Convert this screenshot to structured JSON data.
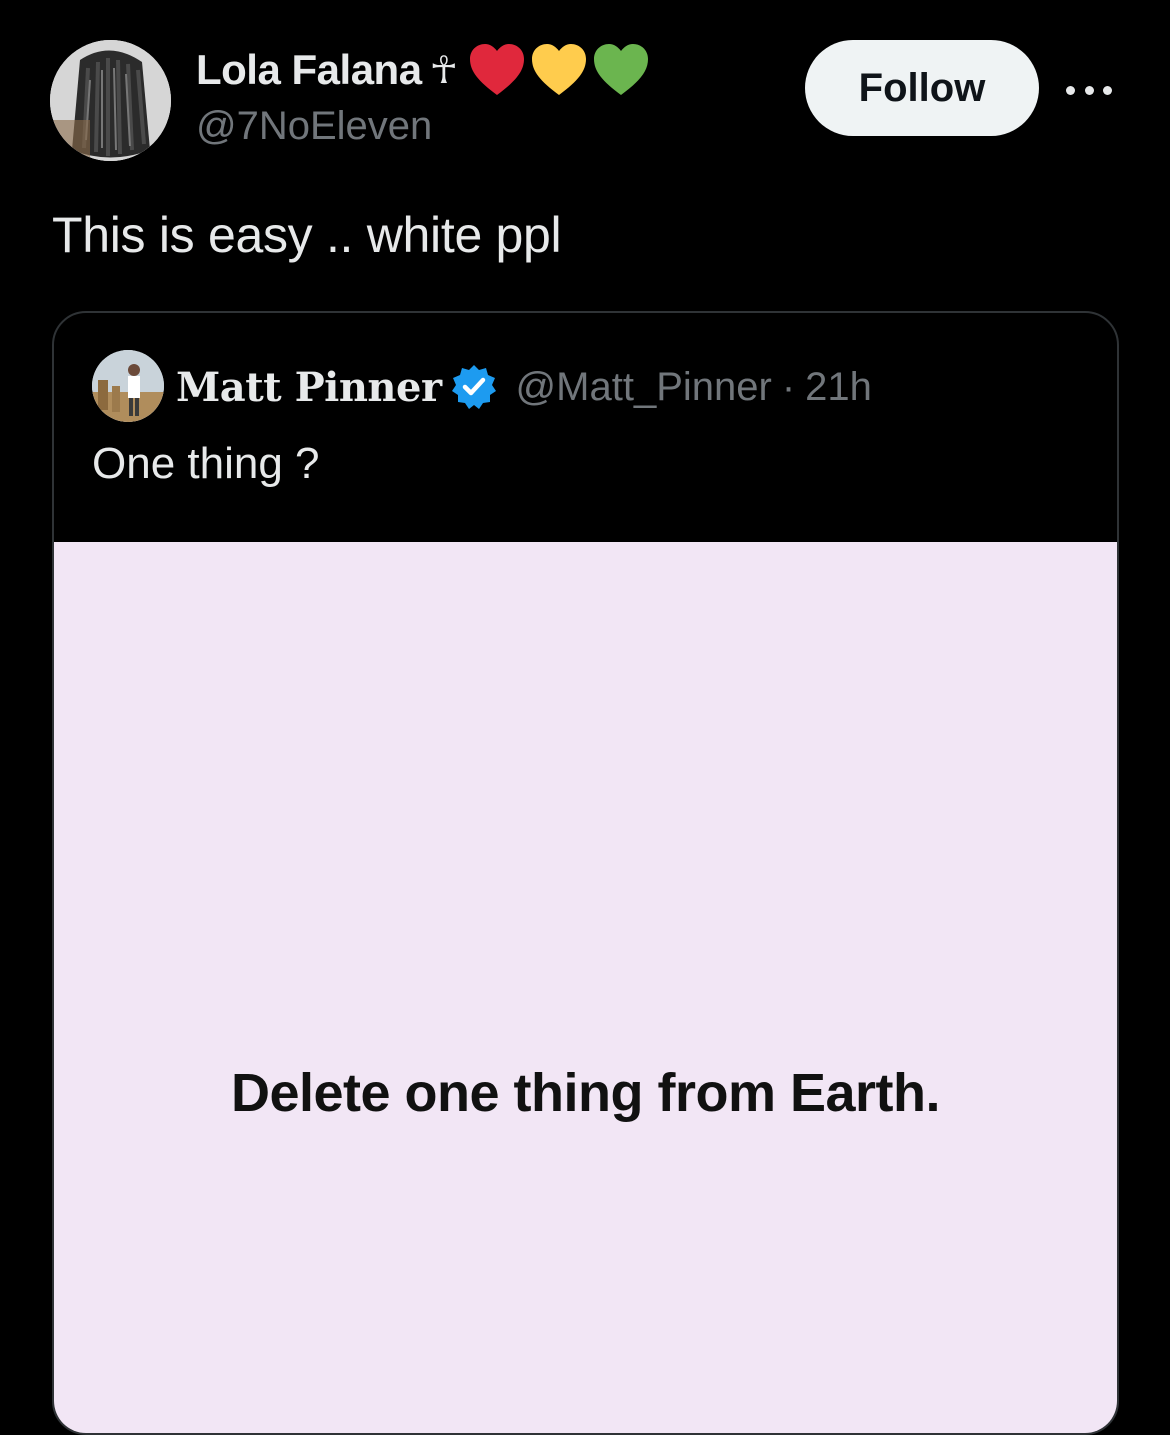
{
  "author": {
    "display_name": "Lola Falana",
    "ankh_symbol": "☥",
    "hearts": [
      "red-heart",
      "yellow-heart",
      "green-heart"
    ],
    "handle": "@7NoEleven"
  },
  "actions": {
    "follow_label": "Follow",
    "more_icon": "more-horizontal-icon"
  },
  "tweet": {
    "text": "This is easy .. white ppl"
  },
  "quoted_tweet": {
    "display_name": "Matt Pinner",
    "verified": true,
    "handle": "@Matt_Pinner",
    "separator": "·",
    "time": "21h",
    "text": "One thing ?",
    "media_text": "Delete one thing from Earth."
  },
  "colors": {
    "background": "#000000",
    "primary_text": "#e7e9ea",
    "secondary_text": "#71767b",
    "follow_bg": "#eff3f4",
    "verified_blue": "#1d9bf0",
    "heart_red": "#e0283c",
    "heart_yellow": "#ffcc4d",
    "heart_green": "#6bb54f",
    "media_bg": "#f2e6f5"
  }
}
